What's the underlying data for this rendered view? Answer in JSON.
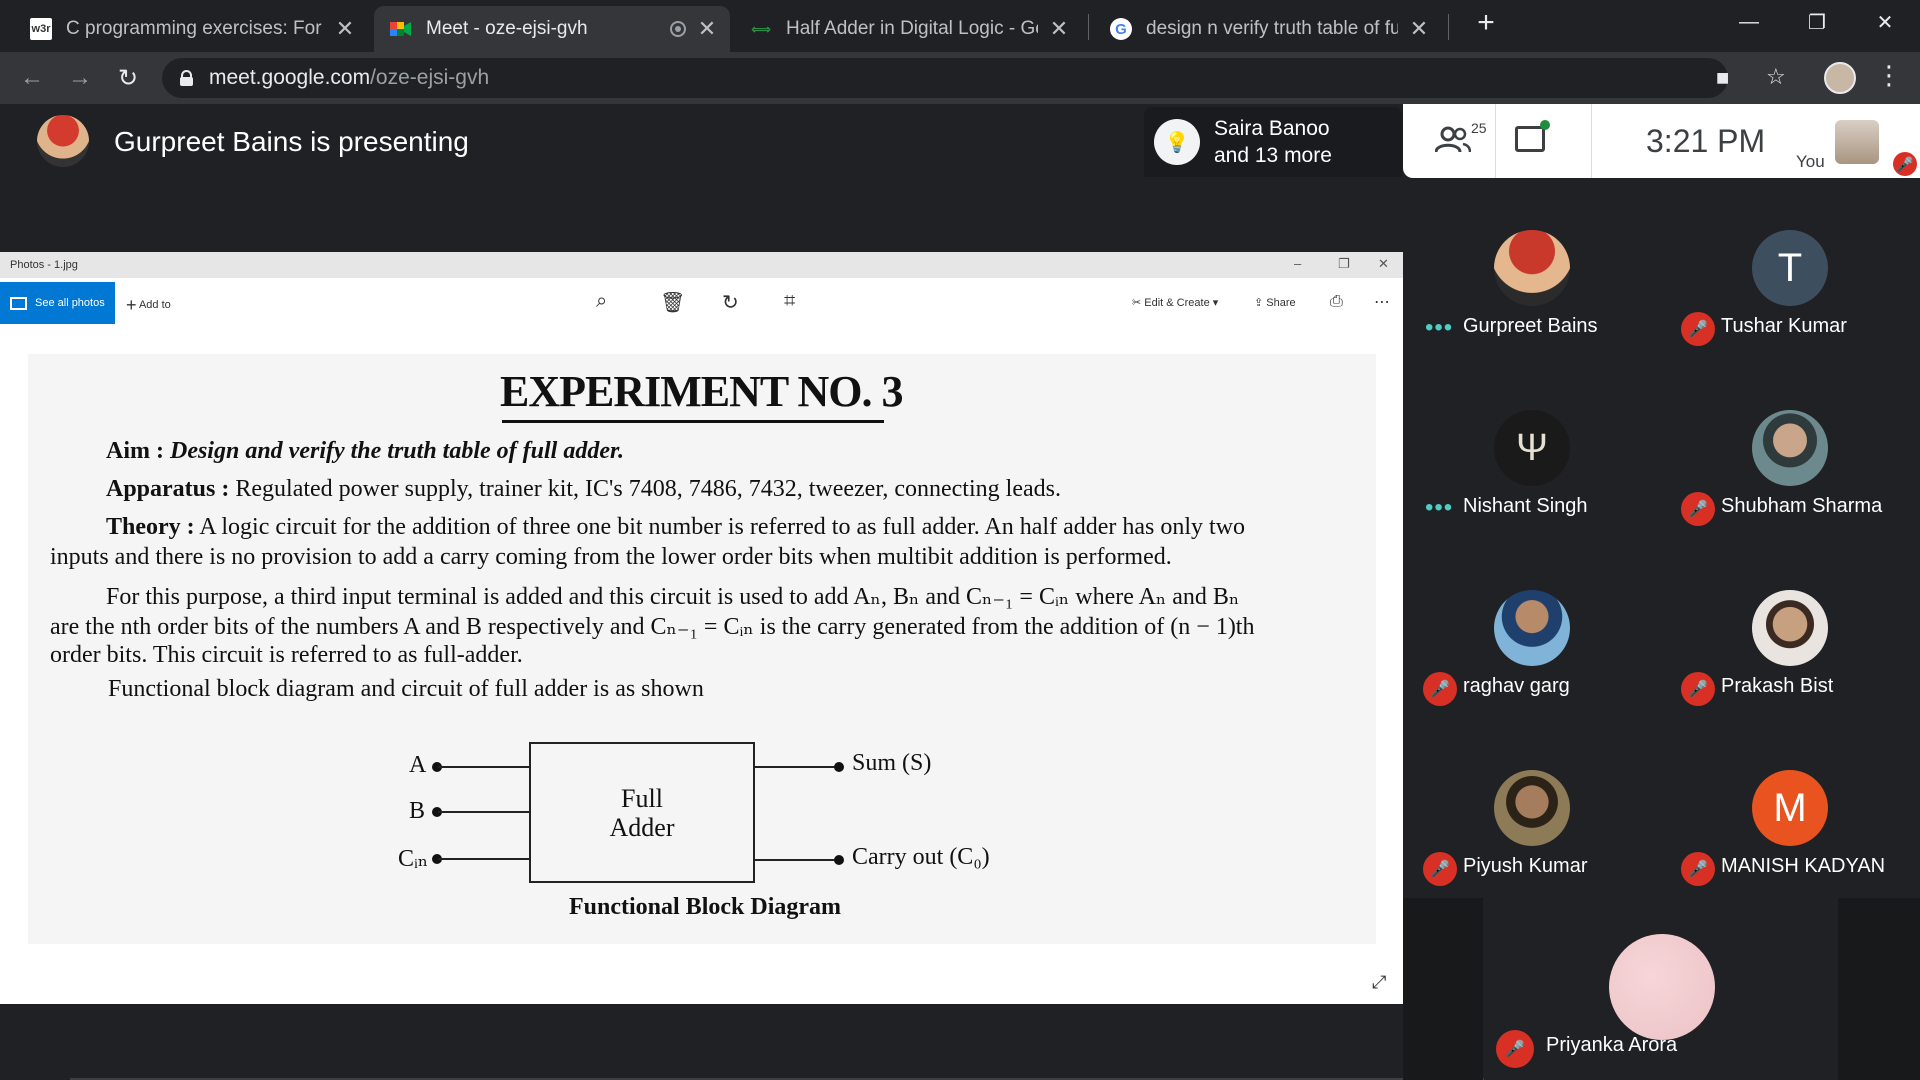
{
  "browser": {
    "tabs": [
      {
        "title": "C programming exercises: For Lo",
        "favicon": "w3r"
      },
      {
        "title": "Meet - oze-ejsi-gvh",
        "favicon": "meet-icon"
      },
      {
        "title": "Half Adder in Digital Logic - Geel",
        "favicon": "geeks-icon"
      },
      {
        "title": "design n verify truth table of full",
        "favicon": "google-icon"
      }
    ],
    "url_host": "meet.google.com",
    "url_path": "/oze-ejsi-gvh"
  },
  "meet": {
    "presenting_text": "Gurpreet Bains is presenting",
    "others_line1": "Saira Banoo",
    "others_line2": "and 13 more",
    "participant_count": "25",
    "clock": "3:21 PM",
    "you_label": "You"
  },
  "photos": {
    "window_title": "Photos - 1.jpg",
    "see_all": "See all photos",
    "add_to": "Add to",
    "edit_create": "Edit & Create",
    "share": "Share"
  },
  "document": {
    "heading": "EXPERIMENT NO. 3",
    "aim_label": "Aim :",
    "aim_text": "Design and verify the truth table of full adder.",
    "apparatus_label": "Apparatus :",
    "apparatus_text": "Regulated power supply, trainer kit, IC's 7408, 7486, 7432, tweezer, connecting leads.",
    "theory_label": "Theory :",
    "theory_line1": "A logic circuit for the addition of three one bit number is referred to as full adder. An half adder has only two",
    "theory_line2": "inputs and there is no provision to add a carry coming from the lower order bits when multibit addition is performed.",
    "para2_line1": "For this purpose, a third input terminal is added and this circuit is used to add Aₙ, Bₙ and Cₙ₋₁ = Cᵢₙ where Aₙ and Bₙ",
    "para2_line2": "are the nth order bits of the numbers A and B respectively and Cₙ₋₁ = Cᵢₙ is the carry generated from the addition of (n − 1)th",
    "para2_line3": "order bits. This circuit is referred to as full-adder.",
    "para3": "Functional block diagram and circuit of full adder is as shown",
    "block_line1": "Full",
    "block_line2": "Adder",
    "in_a": "A",
    "in_b": "B",
    "in_cin": "Cᵢₙ",
    "out_sum": "Sum (S)",
    "out_carry": "Carry out (C₀)",
    "caption": "Functional Block Diagram"
  },
  "participants": [
    {
      "name": "Gurpreet Bains",
      "state": "speaking",
      "avatar": "photo",
      "color": "#b33a2e"
    },
    {
      "name": "Tushar Kumar",
      "state": "muted",
      "avatar": "T",
      "color": "#3d4f5e"
    },
    {
      "name": "Nishant Singh",
      "state": "speaking",
      "avatar": "trident-icon",
      "color": "#1a1a1a"
    },
    {
      "name": "Shubham Sharma",
      "state": "muted",
      "avatar": "photo",
      "color": "#6c8a8d"
    },
    {
      "name": "raghav garg",
      "state": "muted",
      "avatar": "photo",
      "color": "#4f7fae"
    },
    {
      "name": "Prakash Bist",
      "state": "muted",
      "avatar": "photo",
      "color": "#c9b7a6"
    },
    {
      "name": "Piyush Kumar",
      "state": "muted",
      "avatar": "photo",
      "color": "#7a6b4f"
    },
    {
      "name": "MANISH KADYAN",
      "state": "muted",
      "avatar": "M",
      "color": "#e8531f"
    },
    {
      "name": "Priyanka Arora",
      "state": "muted",
      "avatar": "photo",
      "color": "#f2cfd2"
    }
  ]
}
